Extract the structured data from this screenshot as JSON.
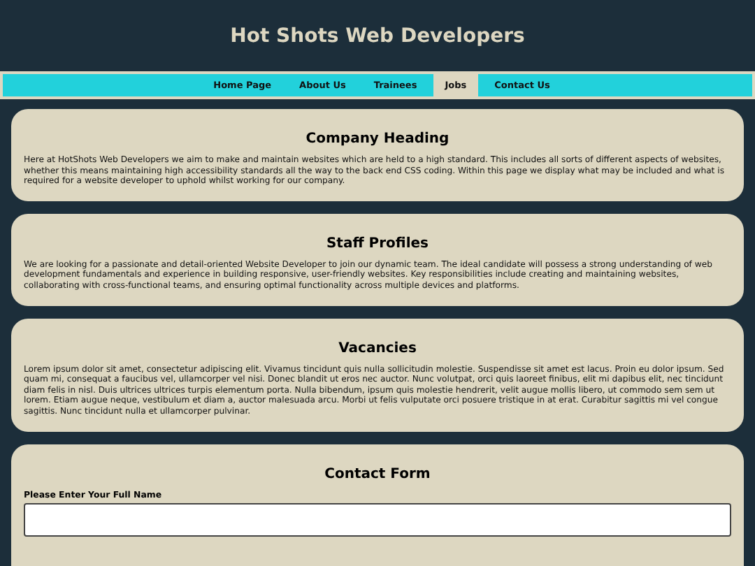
{
  "header": {
    "title": "Hot Shots Web Developers"
  },
  "nav": [
    {
      "label": "Home Page",
      "selected": false
    },
    {
      "label": "About Us",
      "selected": false
    },
    {
      "label": "Trainees",
      "selected": false
    },
    {
      "label": "Jobs",
      "selected": true
    },
    {
      "label": "Contact Us",
      "selected": false
    }
  ],
  "sections": [
    {
      "heading": "Company Heading",
      "text": "Here at HotShots Web Developers we aim to make and maintain websites which are held to a high standard. This includes all sorts of different aspects of websites, whether this means maintaining high accessibility standards all the way to the back end CSS coding. Within this page we display what may be included and what is required for a website developer to uphold whilst working for our company."
    },
    {
      "heading": "Staff Profiles",
      "text": "We are looking for a passionate and detail-oriented Website Developer to join our dynamic team. The ideal candidate will possess a strong understanding of web development fundamentals and experience in building responsive, user-friendly websites. Key responsibilities include creating and maintaining websites, collaborating with cross-functional teams, and ensuring optimal functionality across multiple devices and platforms."
    },
    {
      "heading": "Vacancies",
      "text": "Lorem ipsum dolor sit amet, consectetur adipiscing elit. Vivamus tincidunt quis nulla sollicitudin molestie. Suspendisse sit amet est lacus. Proin eu dolor ipsum. Sed quam mi, consequat a faucibus vel, ullamcorper vel nisi. Donec blandit ut eros nec auctor. Nunc volutpat, orci quis laoreet finibus, elit mi dapibus elit, nec tincidunt diam felis in nisl. Duis ultrices ultrices turpis elementum porta. Nulla bibendum, ipsum quis molestie hendrerit, velit augue mollis libero, ut commodo sem sem ut lorem. Etiam augue neque, vestibulum et diam a, auctor malesuada arcu. Morbi ut felis vulputate orci posuere tristique in at erat. Curabitur sagittis mi vel congue sagittis. Nunc tincidunt nulla et ullamcorper pulvinar."
    }
  ],
  "contact_form": {
    "heading": "Contact Form",
    "fields": [
      {
        "label": "Please Enter Your Full Name"
      }
    ]
  }
}
